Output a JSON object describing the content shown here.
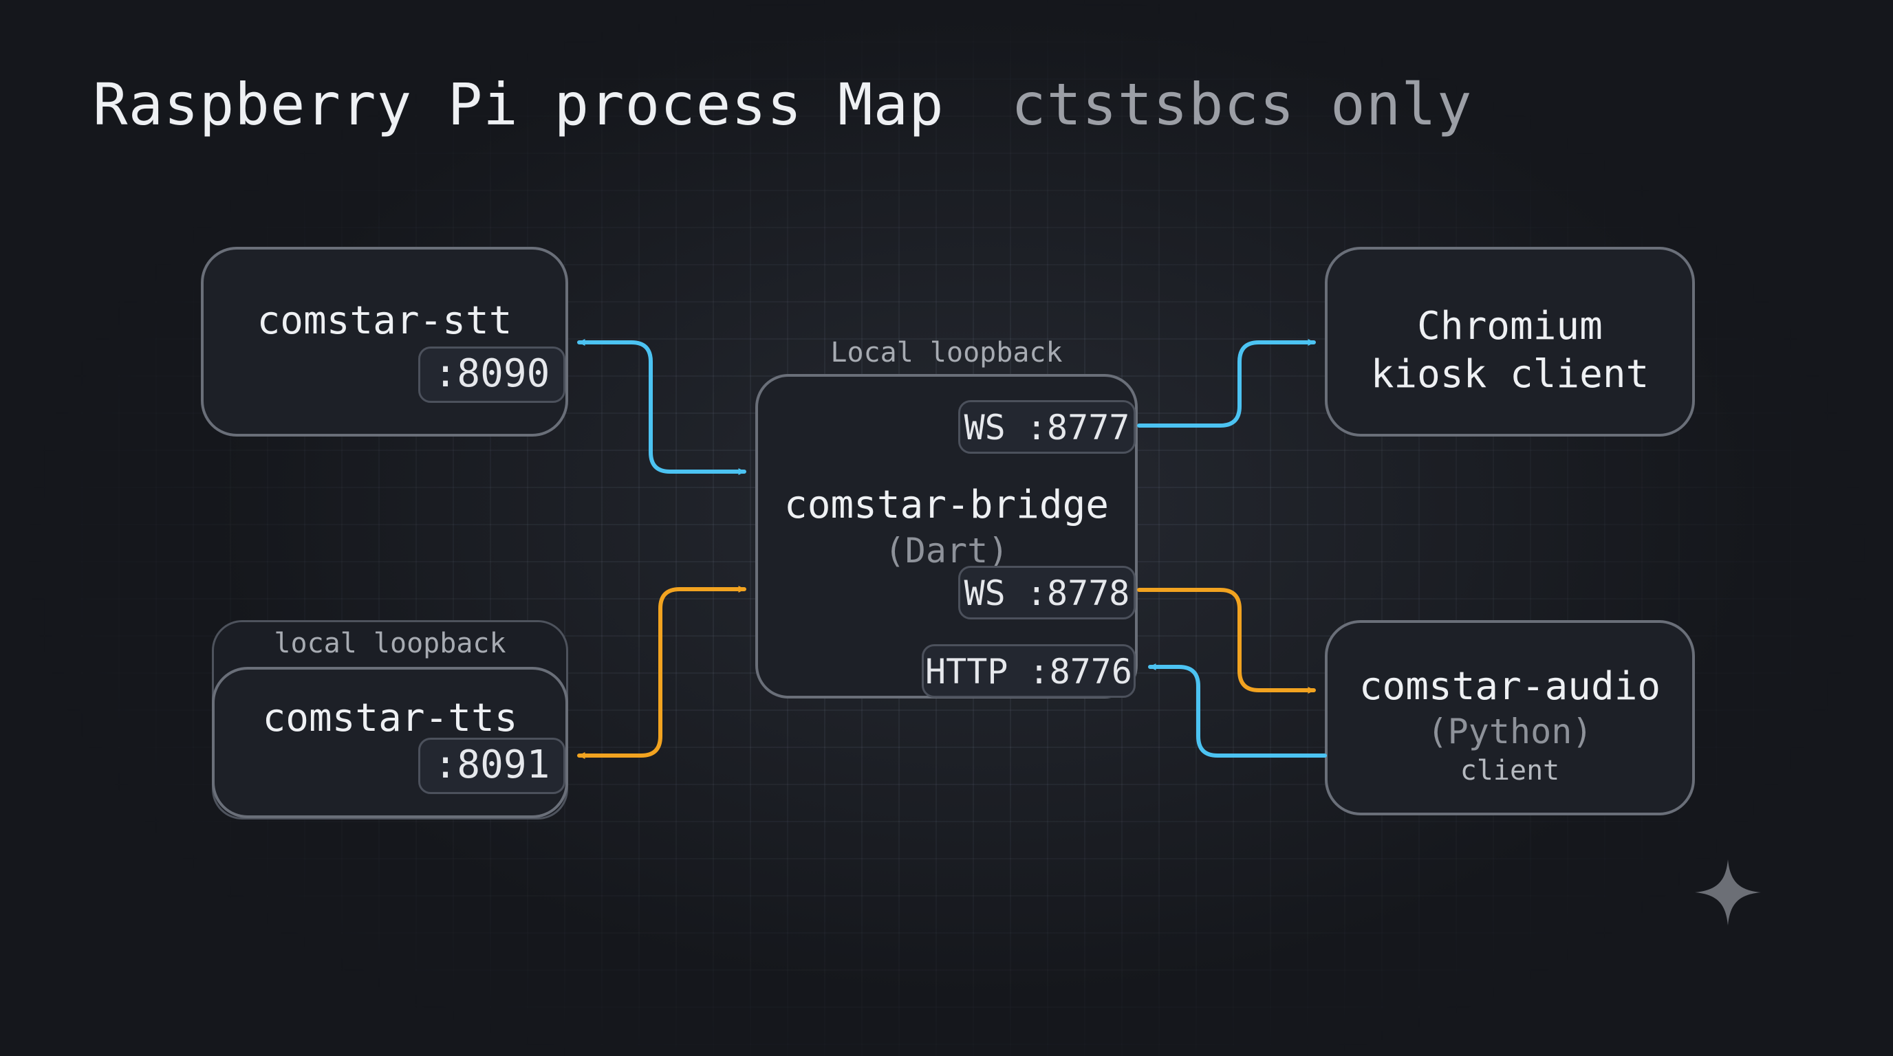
{
  "title": {
    "main": "Raspberry Pi process Map",
    "sub": "ctstsbcs only"
  },
  "nodes": {
    "stt": {
      "name": "comstar-stt",
      "port": ":8090"
    },
    "tts": {
      "name": "comstar-tts",
      "port": ":8091",
      "group_label": "local loopback"
    },
    "bridge": {
      "group_label": "Local loopback",
      "name": "comstar-bridge",
      "lang": "(Dart)",
      "ports": [
        "WS :8777",
        "WS :8778",
        "HTTP :8776"
      ]
    },
    "chromium": {
      "line1": "Chromium",
      "line2": "kiosk client"
    },
    "audio": {
      "name": "comstar-audio",
      "lang": "(Python)",
      "role": "client"
    }
  },
  "colors": {
    "background": "#15171c",
    "box_fill": "#1d2027",
    "box_border": "#6a6f79",
    "connector_blue": "#4cc3f2",
    "connector_orange": "#f2a320"
  },
  "icons": {
    "corner_mark": "sparkle-icon"
  }
}
